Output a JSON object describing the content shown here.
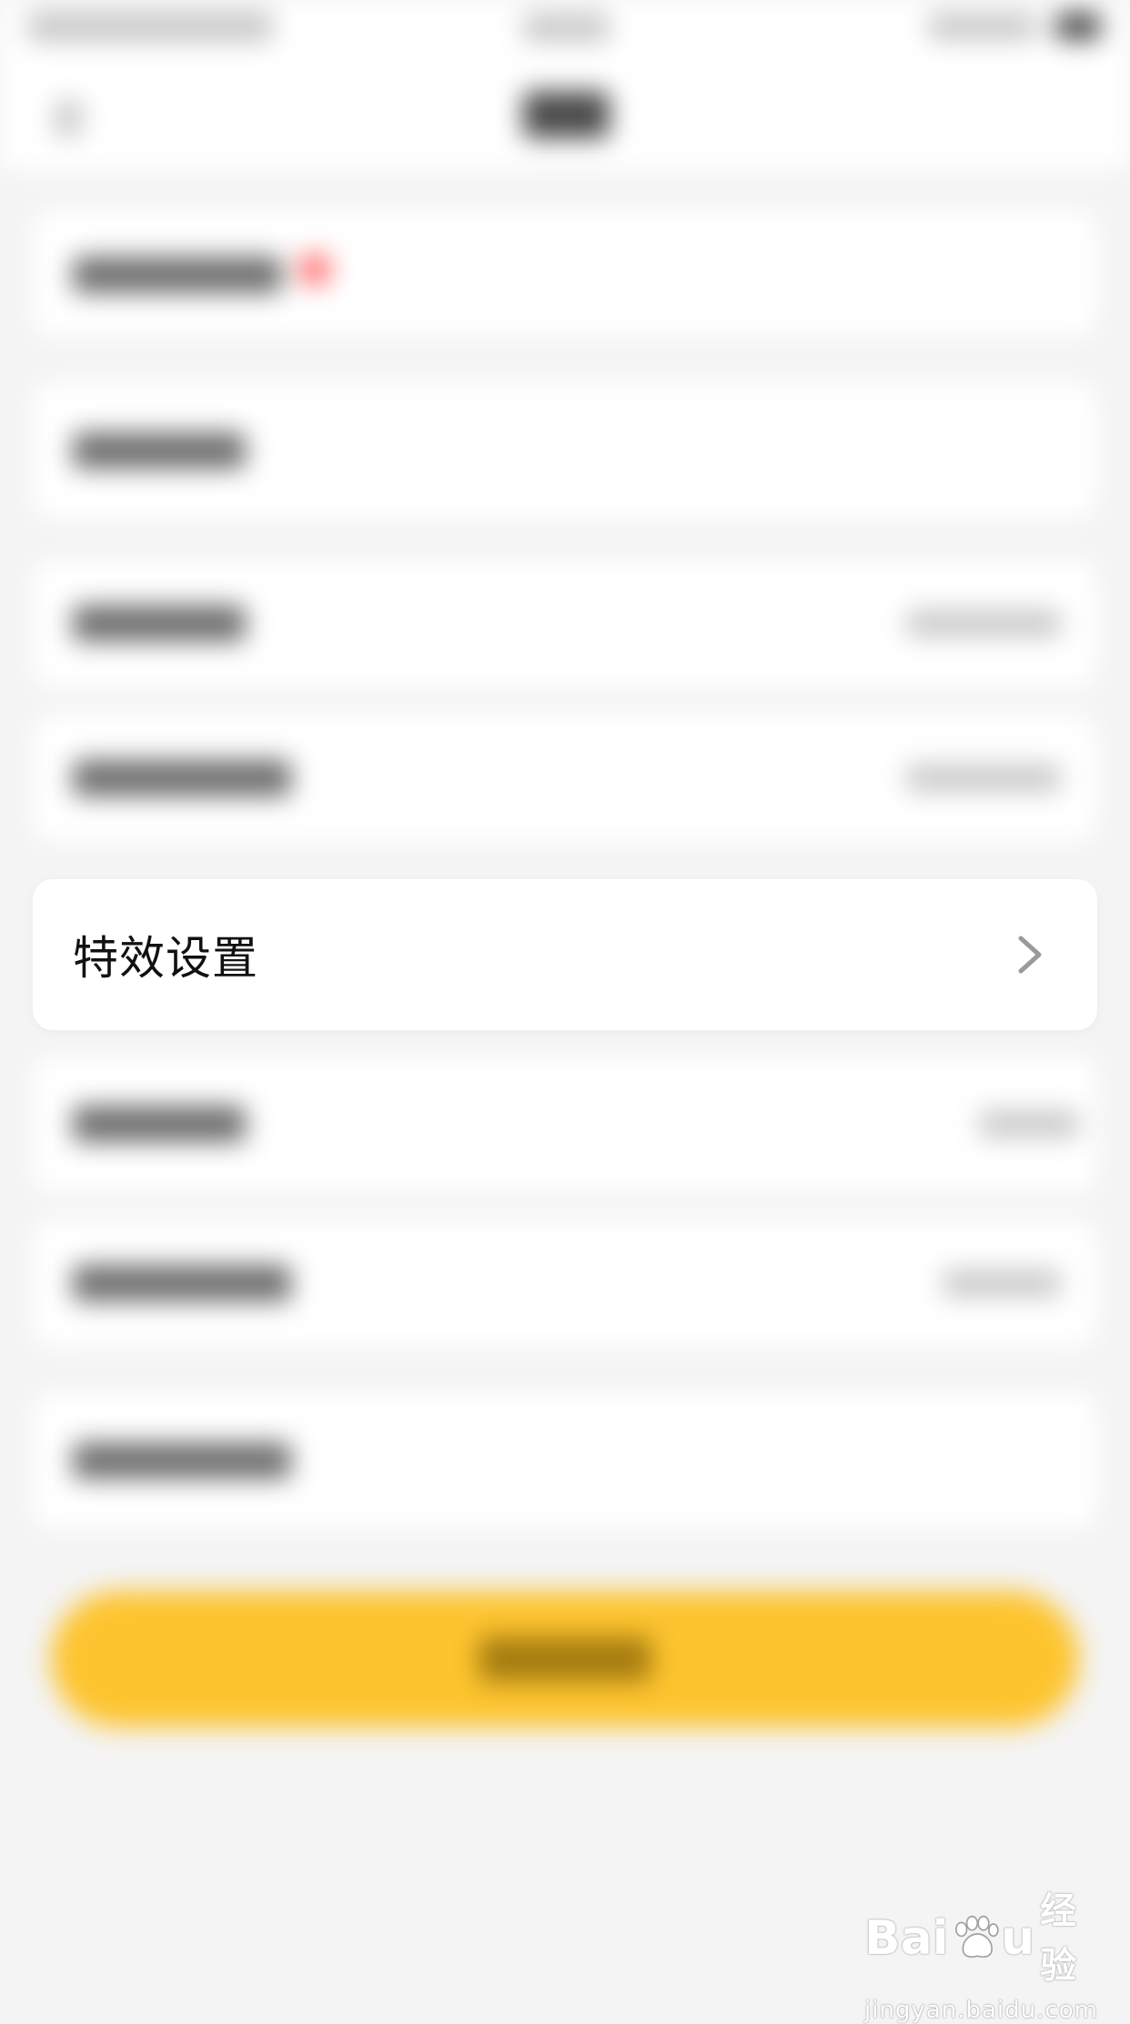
{
  "focused_row": {
    "label": "特效设置"
  },
  "icons": {
    "chevron": "chevron-right-icon",
    "watermark_paw": "baidu-paw-icon"
  },
  "watermark": {
    "brand_left": "Bai",
    "brand_right": "u",
    "brand_cn": "经验",
    "url": "jingyan.baidu.com"
  },
  "colors": {
    "page_background": "#f4f4f4",
    "card_background": "#ffffff",
    "primary_button": "#fdc42f",
    "badge": "#ff6b6b",
    "chevron": "#9a9a9a"
  }
}
